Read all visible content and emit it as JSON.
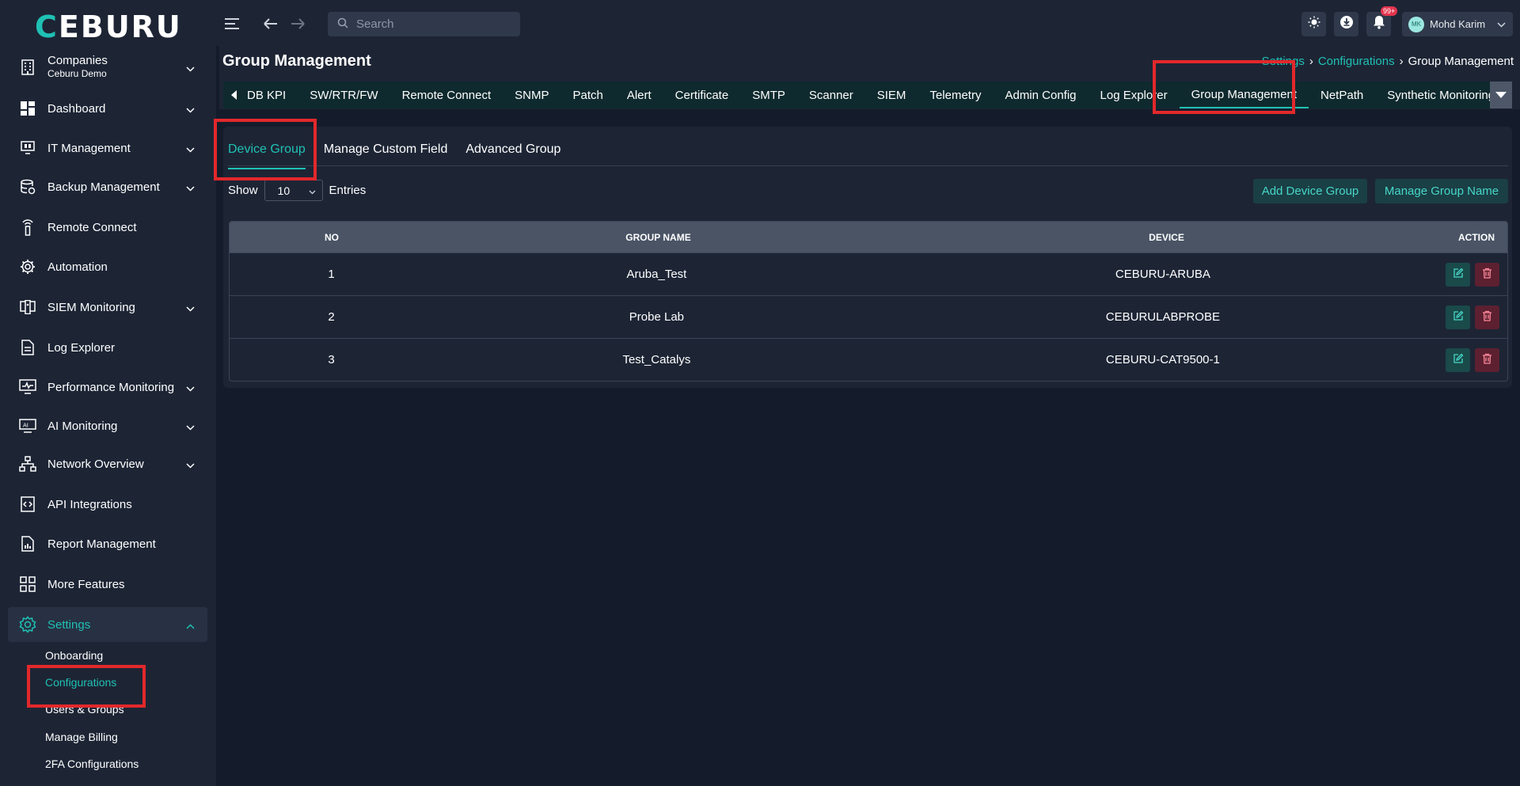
{
  "header": {
    "logo_prefix": "C",
    "logo_rest": "EBURU",
    "search_placeholder": "Search",
    "notification_count": "99+",
    "user_initials": "MK",
    "user_name": "Mohd Karim"
  },
  "sidebar": {
    "company_label": "Companies",
    "company_name": "Ceburu Demo",
    "items": [
      {
        "label": "Dashboard",
        "icon": "dashboard-icon"
      },
      {
        "label": "IT Management",
        "icon": "it-management-icon"
      },
      {
        "label": "Backup Management",
        "icon": "backup-icon"
      },
      {
        "label": "Remote Connect",
        "icon": "remote-icon"
      },
      {
        "label": "Automation",
        "icon": "automation-gear-icon"
      },
      {
        "label": "SIEM Monitoring",
        "icon": "siem-icon"
      },
      {
        "label": "Log Explorer",
        "icon": "document-icon"
      },
      {
        "label": "Performance Monitoring",
        "icon": "monitor-icon"
      },
      {
        "label": "AI Monitoring",
        "icon": "ai-icon"
      },
      {
        "label": "Network Overview",
        "icon": "network-icon"
      },
      {
        "label": "API Integrations",
        "icon": "api-icon"
      },
      {
        "label": "Report Management",
        "icon": "report-icon"
      },
      {
        "label": "More Features",
        "icon": "grid-icon"
      },
      {
        "label": "Settings",
        "icon": "settings-gear-icon"
      }
    ],
    "settings_sub": [
      "Onboarding",
      "Configurations",
      "Users & Groups",
      "Manage Billing",
      "2FA Configurations"
    ]
  },
  "page": {
    "title": "Group Management",
    "breadcrumb": [
      "Settings",
      "Configurations",
      "Group Management"
    ]
  },
  "config_tabs": [
    "DB KPI",
    "SW/RTR/FW",
    "Remote Connect",
    "SNMP",
    "Patch",
    "Alert",
    "Certificate",
    "SMTP",
    "Scanner",
    "SIEM",
    "Telemetry",
    "Admin Config",
    "Log Explorer",
    "Group Management",
    "NetPath",
    "Synthetic Monitoring"
  ],
  "sub_tabs": [
    "Device Group",
    "Manage Custom Field",
    "Advanced Group"
  ],
  "entries": {
    "show_label": "Show",
    "value": "10",
    "entries_label": "Entries"
  },
  "buttons": {
    "add_device_group": "Add Device Group",
    "manage_group_name": "Manage Group Name"
  },
  "table": {
    "headers": {
      "no": "NO",
      "group_name": "GROUP NAME",
      "device": "DEVICE",
      "action": "ACTION"
    },
    "rows": [
      {
        "no": "1",
        "group_name": "Aruba_Test",
        "device": "CEBURU-ARUBA"
      },
      {
        "no": "2",
        "group_name": "Probe Lab",
        "device": "CEBURULABPROBE"
      },
      {
        "no": "3",
        "group_name": "Test_Catalys",
        "device": "CEBURU-CAT9500-1"
      }
    ]
  },
  "colors": {
    "accent": "#1fc1b4",
    "highlight": "#e3282b",
    "background": "#141c2b",
    "panel": "#1d2535"
  }
}
